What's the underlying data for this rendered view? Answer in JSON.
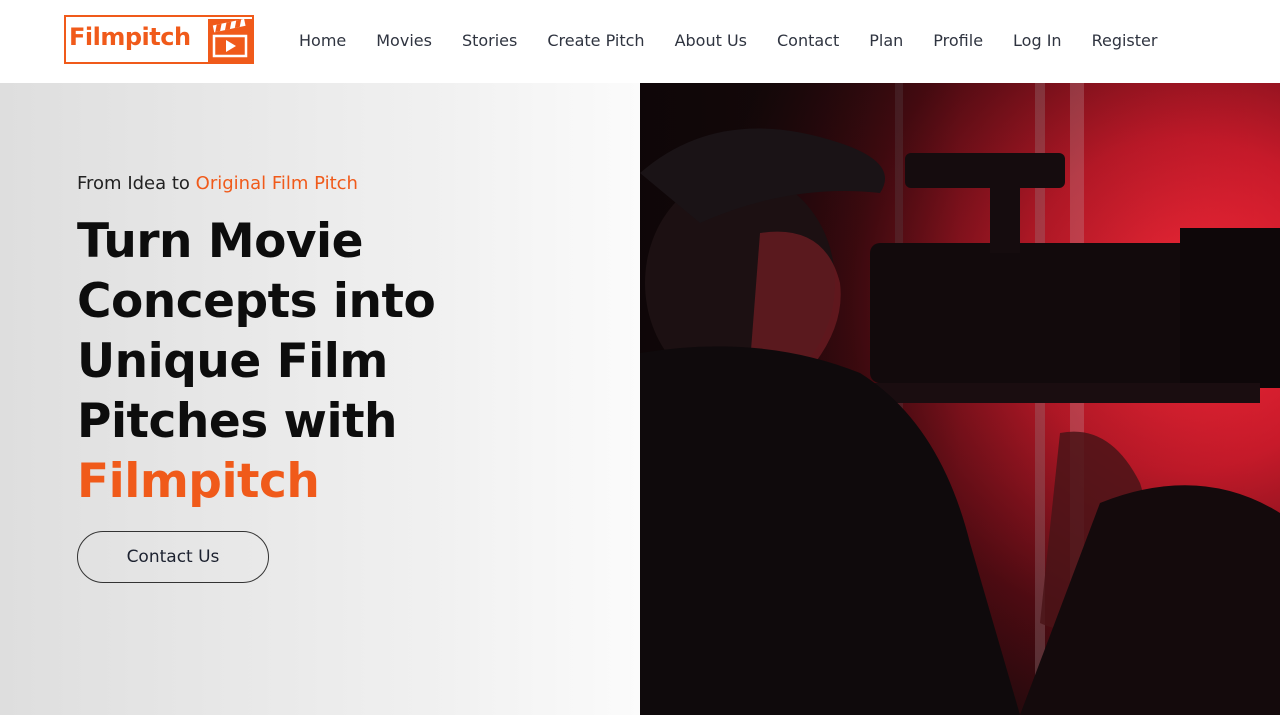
{
  "brand": {
    "logo_text": "Filmpitch",
    "accent_color": "#f05a1a"
  },
  "nav": {
    "items": [
      {
        "label": "Home"
      },
      {
        "label": "Movies"
      },
      {
        "label": "Stories"
      },
      {
        "label": "Create Pitch"
      },
      {
        "label": "About Us"
      },
      {
        "label": "Contact"
      },
      {
        "label": "Plan"
      },
      {
        "label": "Profile"
      },
      {
        "label": "Log In"
      },
      {
        "label": "Register"
      }
    ]
  },
  "hero": {
    "eyebrow_prefix": "From Idea to ",
    "eyebrow_accent": "Original Film Pitch",
    "headline_lines": [
      "Turn Movie",
      "Concepts into",
      "Unique Film",
      "Pitches with"
    ],
    "headline_brand": "Filmpitch",
    "cta_label": "Contact Us",
    "image_icon": "camera-operator-photo"
  }
}
